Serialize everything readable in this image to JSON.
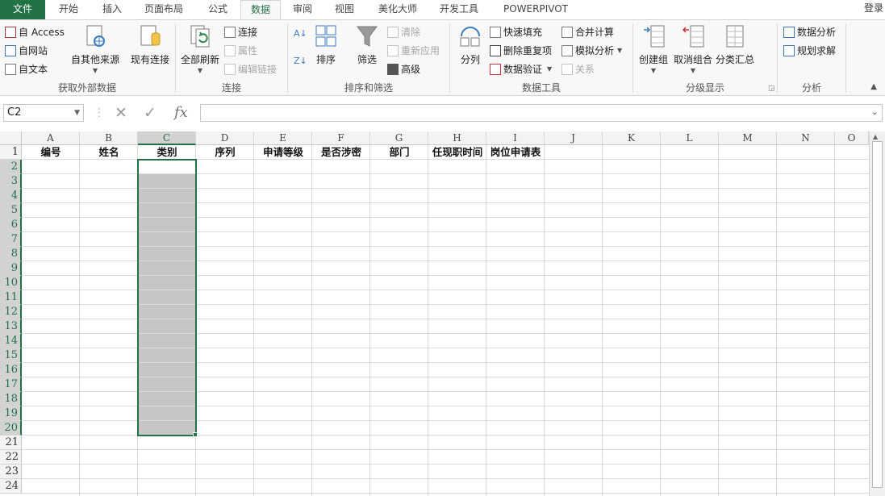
{
  "menu": {
    "tabs": [
      "文件",
      "开始",
      "插入",
      "页面布局",
      "公式",
      "数据",
      "审阅",
      "视图",
      "美化大师",
      "开发工具",
      "POWERPIVOT"
    ],
    "active_tab": "数据",
    "login": "登录"
  },
  "ribbon": {
    "get_external": {
      "label": "获取外部数据",
      "access": "自 Access",
      "web": "自网站",
      "text": "自文本",
      "other_sources": "自其他来源",
      "existing": "现有连接"
    },
    "connections": {
      "label": "连接",
      "refresh_all": "全部刷新",
      "connections": "连接",
      "properties": "属性",
      "edit_links": "编辑链接"
    },
    "sort_filter": {
      "label": "排序和筛选",
      "sort": "排序",
      "filter": "筛选",
      "clear": "清除",
      "reapply": "重新应用",
      "advanced": "高级"
    },
    "data_tools": {
      "label": "数据工具",
      "text_to_columns": "分列",
      "flash_fill": "快速填充",
      "remove_duplicates": "删除重复项",
      "data_validation": "数据验证",
      "consolidate": "合并计算",
      "what_if": "模拟分析",
      "relationships": "关系"
    },
    "outline": {
      "label": "分级显示",
      "group": "创建组",
      "ungroup": "取消组合",
      "subtotal": "分类汇总"
    },
    "analysis": {
      "label": "分析",
      "data_analysis": "数据分析",
      "solver": "规划求解"
    }
  },
  "formula_bar": {
    "name_box": "C2",
    "fx": "fx",
    "value": ""
  },
  "sheet": {
    "columns": [
      "A",
      "B",
      "C",
      "D",
      "E",
      "F",
      "G",
      "H",
      "I",
      "J",
      "K",
      "L",
      "M",
      "N",
      "O"
    ],
    "rows": [
      "1",
      "2",
      "3",
      "4",
      "5",
      "6",
      "7",
      "8",
      "9",
      "10",
      "11",
      "12",
      "13",
      "14",
      "15",
      "16",
      "17",
      "18",
      "19",
      "20",
      "21",
      "22",
      "23",
      "24"
    ],
    "header_row": [
      "编号",
      "姓名",
      "类别",
      "序列",
      "申请等级",
      "是否涉密",
      "部门",
      "任现职时间",
      "岗位申请表"
    ],
    "selected_column": "C",
    "selection": "C2:C20",
    "active_cell": "C2"
  },
  "colors": {
    "accent": "#217346",
    "selection_fill": "#c6c6c6",
    "grid_line": "#dcdcdc"
  }
}
